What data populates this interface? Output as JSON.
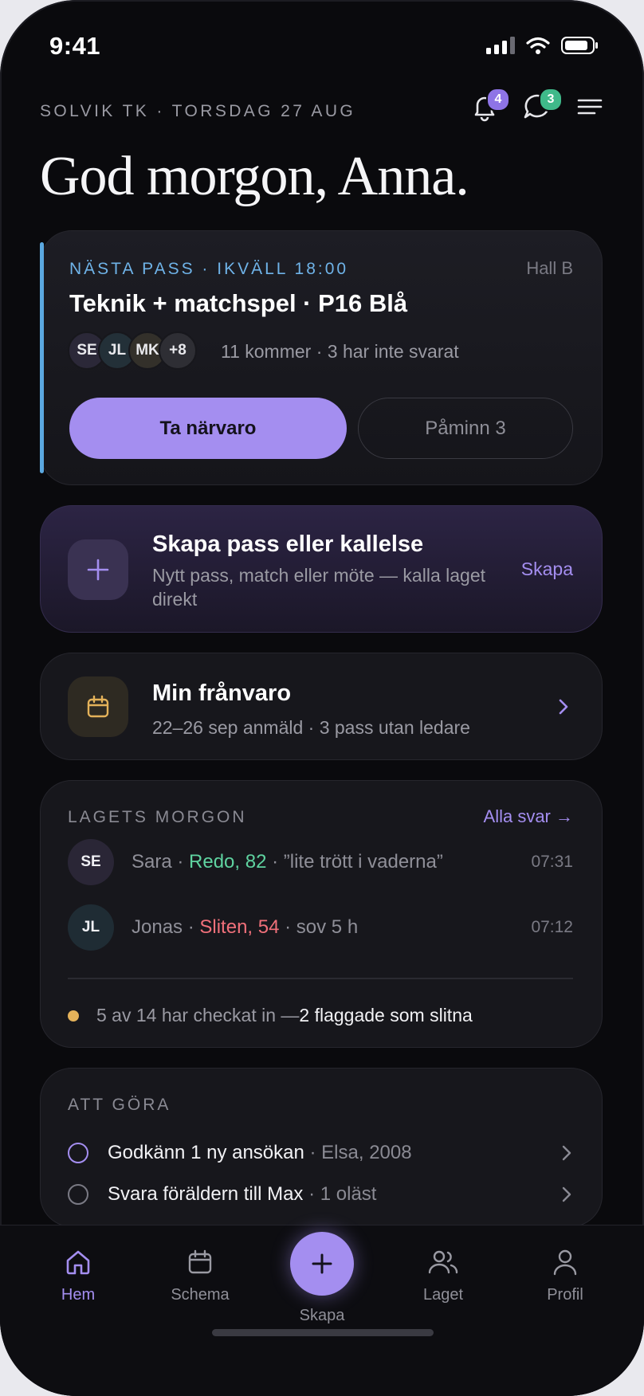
{
  "status": {
    "time": "9:41"
  },
  "header": {
    "club_line": "SOLVIK TK · TORSDAG 27 AUG",
    "greeting": "God morgon, Anna.",
    "notif_count": "4",
    "chat_count": "3"
  },
  "next_session": {
    "label": "NÄSTA PASS · IKVÄLL 18:00",
    "hall": "Hall B",
    "title": "Teknik + matchspel · P16 Blå",
    "avatars": [
      "SE",
      "JL",
      "MK",
      "+8"
    ],
    "summary": "11 kommer · 3 har inte svarat",
    "primary_button": "Ta närvaro",
    "secondary_button": "Påminn 3"
  },
  "create": {
    "title": "Skapa pass eller kallelse",
    "subtitle": "Nytt pass, match eller möte — kalla laget direkt",
    "action": "Skapa"
  },
  "absence": {
    "title": "Min frånvaro",
    "subtitle": "22–26 sep anmäld · 3 pass utan ledare"
  },
  "morning": {
    "label": "LAGETS MORGON",
    "link": "Alla svar →",
    "entries": [
      {
        "initials": "SE",
        "name": "Sara",
        "status": "Redo, 82",
        "note": "”lite trött i vaderna”",
        "time": "07:31"
      },
      {
        "initials": "JL",
        "name": "Jonas",
        "status": "Sliten, 54",
        "note": "sov 5 h",
        "time": "07:12"
      }
    ],
    "checkin_prefix": "5 av 14 har checkat in — ",
    "checkin_flag": "2 flaggade som slitna"
  },
  "todo": {
    "label": "ATT GÖRA",
    "items": [
      {
        "title": "Godkänn 1 ny ansökan",
        "meta": " · Elsa, 2008"
      },
      {
        "title": "Svara föräldern till Max",
        "meta": " · 1 oläst"
      }
    ]
  },
  "tabs": {
    "home": "Hem",
    "schedule": "Schema",
    "create": "Skapa",
    "team": "Laget",
    "profile": "Profil"
  },
  "colors": {
    "accent": "#a48ef0",
    "info": "#6fb3e8",
    "ready": "#5fd3a0",
    "tired": "#f0707a",
    "warning": "#e4b25a"
  }
}
